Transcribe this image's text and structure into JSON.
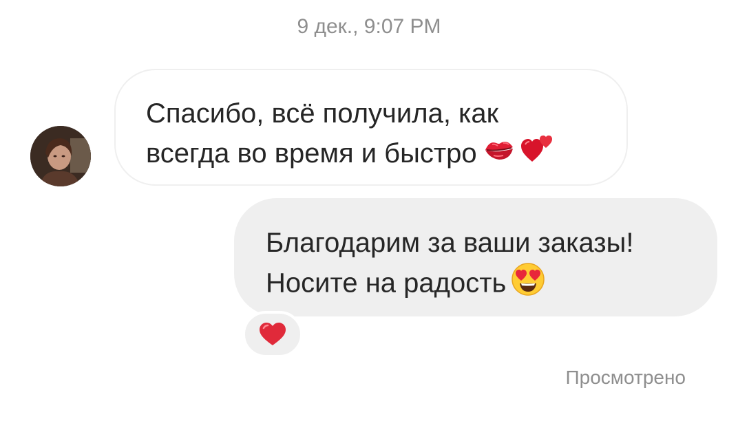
{
  "conversation": {
    "timestamp": "9 дек., 9:07 PM",
    "incoming": {
      "line1": "Спасибо, всё получила, как",
      "line2": "всегда во время и быстро",
      "emojis": [
        "kiss-mark-icon",
        "two-hearts-icon"
      ]
    },
    "outgoing": {
      "line1": "Благодарим за ваши заказы!",
      "line2": "Носите на радость",
      "emojis": [
        "heart-eyes-icon"
      ]
    },
    "reaction": "heart-icon",
    "status": "Просмотрено"
  },
  "colors": {
    "text": "#262626",
    "meta": "#8e8e8e",
    "bubble_out": "#efefef",
    "bubble_in_border": "#efefef",
    "heart": "#e02a3a"
  }
}
